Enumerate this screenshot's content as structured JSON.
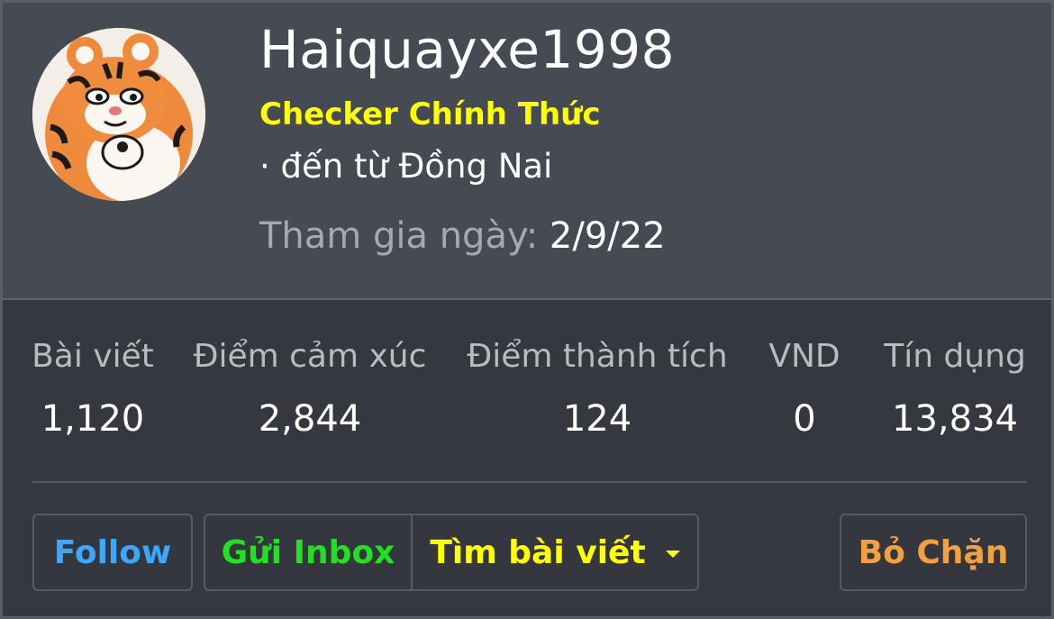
{
  "profile": {
    "username": "Haiquayxe1998",
    "title": "Checker Chính Thức",
    "location": "· đến từ Đồng Nai",
    "joined_label": "Tham gia ngày:",
    "joined_value": "2/9/22"
  },
  "stats": [
    {
      "label": "Bài viết",
      "value": "1,120"
    },
    {
      "label": "Điểm cảm xúc",
      "value": "2,844"
    },
    {
      "label": "Điểm thành tích",
      "value": "124"
    },
    {
      "label": "VND",
      "value": "0"
    },
    {
      "label": "Tín dụng",
      "value": "13,834"
    }
  ],
  "actions": {
    "follow": "Follow",
    "inbox": "Gửi Inbox",
    "find_posts": "Tìm bài viết",
    "unblock": "Bỏ Chặn"
  },
  "colors": {
    "title": "#ffff00",
    "follow": "#3aa8ff",
    "inbox": "#22e022",
    "find_posts": "#ffff00",
    "unblock": "#f5a040"
  },
  "icons": {
    "avatar": "tiger-cartoon-avatar",
    "dropdown": "caret-down-icon"
  }
}
